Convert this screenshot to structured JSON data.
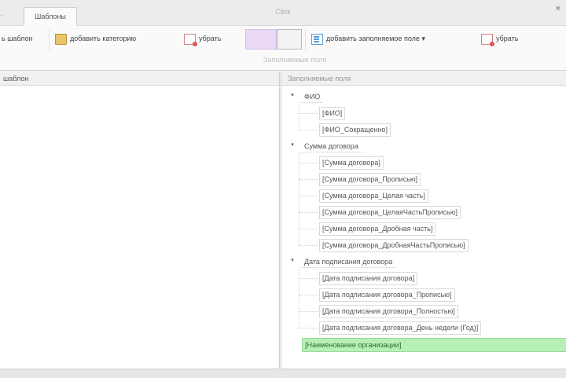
{
  "window": {
    "title": "Click",
    "close_glyph": "×"
  },
  "tabs": [
    {
      "label": "Шаблоны"
    }
  ],
  "ribbon": {
    "create_template_label": "ь шаблон",
    "add_category_label": "добавить категорию",
    "remove_category_label": "убрать",
    "add_field_label": "добавить заполняемое поле",
    "add_field_dropdown": "▾",
    "remove_field_label": "убрать",
    "group_label": "Заполняемые поля",
    "colors": {
      "swatch_a": "#e9d9f6",
      "swatch_b": "#f3f3f3",
      "highlight": "#b7f0b7"
    },
    "icons": {
      "add_category": "folder-icon",
      "remove_category": "remove-icon",
      "add_field": "fields-icon",
      "remove_field": "remove-icon"
    }
  },
  "left_panel": {
    "header": "шаблон"
  },
  "right_panel": {
    "header": "Заполняемые поля",
    "tree": [
      {
        "label": "ФИО",
        "toggle": "▾",
        "children": [
          "[ФИО]",
          "[ФИО_Сокращенно]"
        ]
      },
      {
        "label": "Сумма договора",
        "toggle": "▾",
        "children": [
          "[Сумма договора]",
          "[Сумма договора_Прописью]",
          "[Сумма договора_Целая часть]",
          "[Сумма договора_ЦелаяЧастьПрописью]",
          "[Сумма договора_Дробная часть]",
          "[Сумма договора_ДробнаяЧастьПрописью]"
        ]
      },
      {
        "label": "Дата подписания договора",
        "toggle": "▾",
        "children": [
          "[Дата подписания договора]",
          "[Дата подписания договора_Прописью]",
          "[Дата подписания договора_Полностью]",
          "[Дата подписания договора_День недели (Год)]"
        ]
      }
    ],
    "highlighted_item": "[Наименование организации]"
  },
  "statusbar": {
    "text_1": "",
    "text_2": "",
    "text_3": ""
  }
}
